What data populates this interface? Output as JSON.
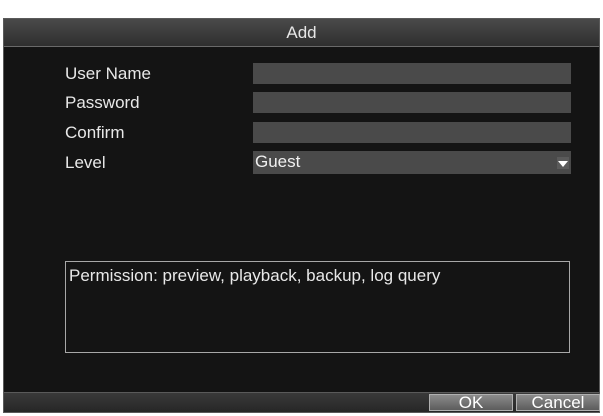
{
  "dialog": {
    "title": "Add"
  },
  "form": {
    "user_name_label": "User Name",
    "user_name_value": "",
    "password_label": "Password",
    "password_value": "",
    "confirm_label": "Confirm",
    "confirm_value": "",
    "level_label": "Level",
    "level_value": "Guest"
  },
  "permission": {
    "text": "Permission: preview, playback, backup, log query"
  },
  "buttons": {
    "ok_label": "OK",
    "cancel_label": "Cancel"
  },
  "icons": {
    "level_dropdown": "chevron-down-icon"
  },
  "colors": {
    "background": "#141414",
    "field": "#4a4a4a",
    "text": "#e8e8e8"
  }
}
